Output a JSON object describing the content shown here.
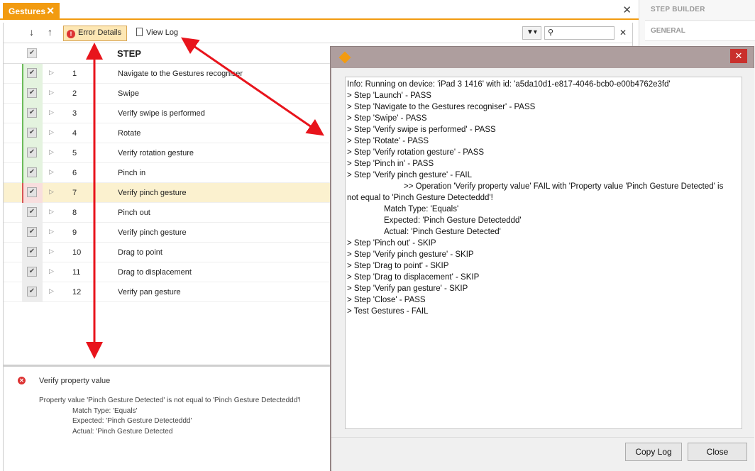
{
  "tab": {
    "title": "Gestures",
    "close_glyph": "✕"
  },
  "editor_close_glyph": "✕",
  "right_panel": {
    "title": "STEP BUILDER",
    "section": "GENERAL"
  },
  "toolbar": {
    "move_down_glyph": "↓",
    "move_up_glyph": "↑",
    "error_details_label": "Error Details",
    "view_log_label": "View Log",
    "filter_glyph": "▼▾",
    "search_glyph": "⚲",
    "search_value": "",
    "clear_glyph": "✕"
  },
  "grid": {
    "header_step": "STEP",
    "check_glyph": "✔",
    "expander_glyph": "▷",
    "rows": [
      {
        "num": "1",
        "name": "Navigate to the Gestures recogniser",
        "status": "pass"
      },
      {
        "num": "2",
        "name": "Swipe",
        "status": "pass"
      },
      {
        "num": "3",
        "name": "Verify swipe is performed",
        "status": "pass"
      },
      {
        "num": "4",
        "name": "Rotate",
        "status": "pass"
      },
      {
        "num": "5",
        "name": "Verify rotation gesture",
        "status": "pass"
      },
      {
        "num": "6",
        "name": "Pinch in",
        "status": "pass"
      },
      {
        "num": "7",
        "name": "Verify pinch gesture",
        "status": "fail",
        "selected": true
      },
      {
        "num": "8",
        "name": "Pinch out",
        "status": "skip"
      },
      {
        "num": "9",
        "name": "Verify pinch gesture",
        "status": "skip"
      },
      {
        "num": "10",
        "name": "Drag to point",
        "status": "skip"
      },
      {
        "num": "11",
        "name": "Drag to displacement",
        "status": "skip"
      },
      {
        "num": "12",
        "name": "Verify pan gesture",
        "status": "skip"
      }
    ]
  },
  "details": {
    "title": "Verify property value",
    "line1": "Property value 'Pinch Gesture Detected' is not equal to 'Pinch Gesture Detecteddd'!",
    "line2": "Match Type: 'Equals'",
    "line3": "Expected: 'Pinch Gesture Detecteddd'",
    "line4": "Actual: 'Pinch Gesture Detected"
  },
  "dialog": {
    "close_glyph": "✕",
    "log_lines": [
      "Info: Running on device: 'iPad 3 1416' with id: 'a5da10d1-e817-4046-bcb0-e00b4762e3fd'",
      "> Step 'Launch' - PASS",
      "> Step 'Navigate to the Gestures recogniser' - PASS",
      "> Step 'Swipe' - PASS",
      "> Step 'Verify swipe is performed' - PASS",
      "> Step 'Rotate' - PASS",
      "> Step 'Verify rotation gesture' - PASS",
      "> Step 'Pinch in' - PASS",
      "> Step 'Verify pinch gesture' - FAIL",
      ">> Operation 'Verify property value' FAIL with 'Property value 'Pinch Gesture Detected' is not equal to 'Pinch Gesture Detecteddd'!",
      "Match Type: 'Equals'",
      "Expected: 'Pinch Gesture Detecteddd'",
      "Actual: 'Pinch Gesture Detected'",
      "> Step 'Pinch out' - SKIP",
      "> Step 'Verify pinch gesture' - SKIP",
      "> Step 'Drag to point' - SKIP",
      "> Step 'Drag to displacement' - SKIP",
      "> Step 'Verify pan gesture' - SKIP",
      "> Step 'Close' - PASS",
      "> Test Gestures - FAIL"
    ],
    "copy_label": "Copy Log",
    "close_label": "Close"
  },
  "colors": {
    "accent": "#f29b10",
    "pass": "#6cbb5a",
    "fail": "#d75454",
    "annotation": "#e8141c"
  }
}
